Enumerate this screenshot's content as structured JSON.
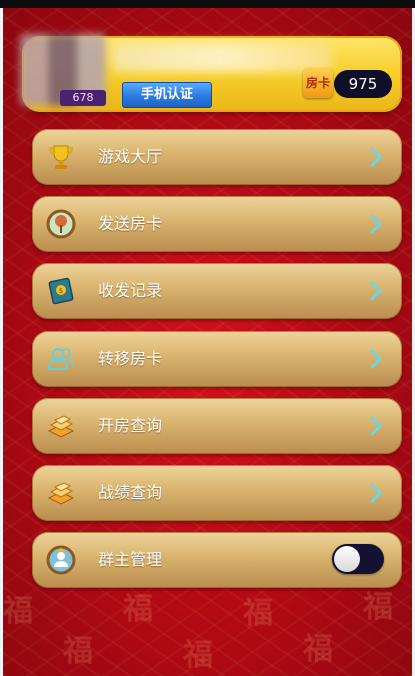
{
  "profile": {
    "verify_button": "手机认证",
    "card_icon_char": "房卡",
    "card_count": "975",
    "avatar_badge": "678"
  },
  "menu": [
    {
      "label": "游戏大厅",
      "icon": "trophy-icon",
      "action": "chevron"
    },
    {
      "label": "发送房卡",
      "icon": "tree-medal-icon",
      "action": "chevron"
    },
    {
      "label": "收发记录",
      "icon": "record-book-icon",
      "action": "chevron"
    },
    {
      "label": "转移房卡",
      "icon": "users-transfer-icon",
      "action": "chevron"
    },
    {
      "label": "开房查询",
      "icon": "book-stack-icon",
      "action": "chevron"
    },
    {
      "label": "战绩查询",
      "icon": "book-stack-icon",
      "action": "chevron"
    },
    {
      "label": "群主管理",
      "icon": "group-owner-icon",
      "action": "toggle",
      "toggle_on": false
    }
  ],
  "colors": {
    "chevron": "#6ad6e6",
    "background": "#c40f18",
    "card_bg": "#f7cf2a"
  }
}
